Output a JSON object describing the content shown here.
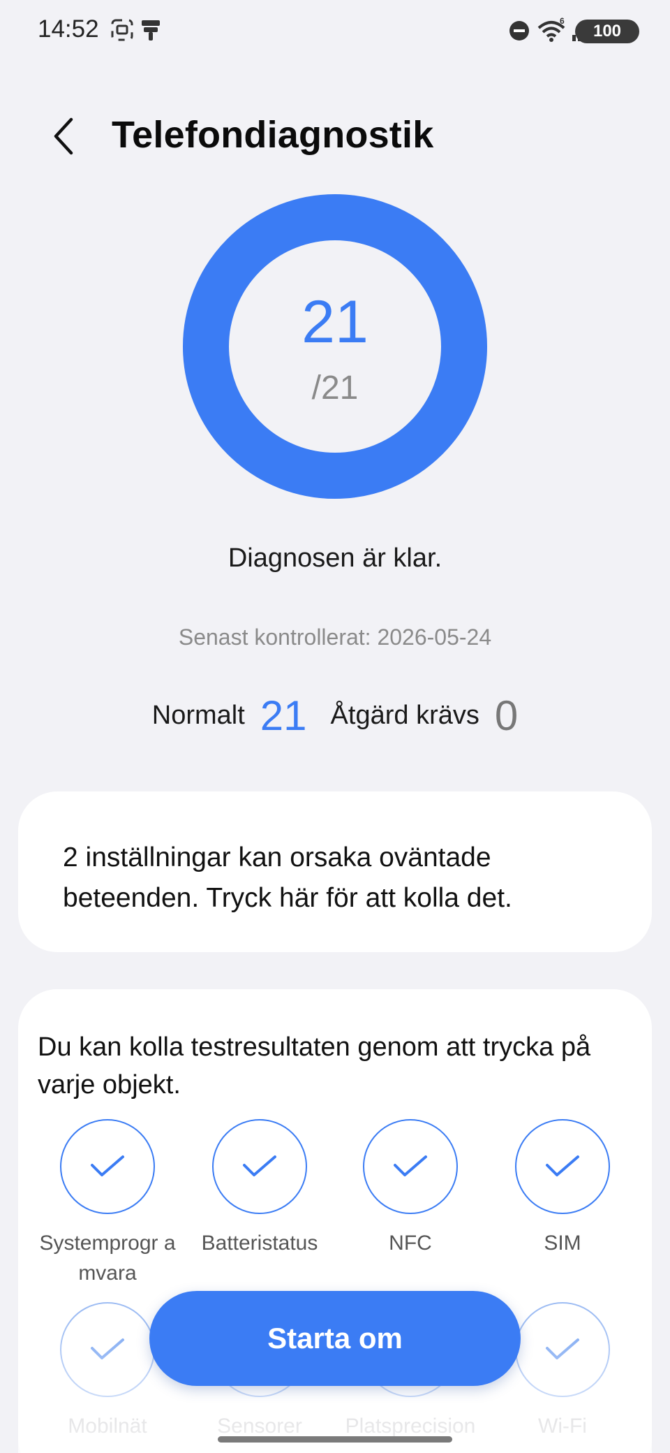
{
  "status_bar": {
    "time": "14:52",
    "battery": "100",
    "icons": [
      "screenshot-icon",
      "broom-icon",
      "do-not-disturb-icon",
      "wifi-icon",
      "signal-icon"
    ],
    "wifi_badge": "6"
  },
  "header": {
    "title": "Telefondiagnostik",
    "back_icon": "chevron-left-icon"
  },
  "score": {
    "value": "21",
    "total": "/21",
    "fraction": 1.0,
    "accent_color": "#3b7cf4"
  },
  "diagnosis_status": "Diagnosen är klar.",
  "last_checked": "Senast kontrollerat: 2026-05-24",
  "counts": {
    "normal_label": "Normalt",
    "normal_value": "21",
    "action_label": "Åtgärd krävs",
    "action_value": "0"
  },
  "settings_card": {
    "text": "2 inställningar kan orsaka oväntade beteenden. Tryck här för att kolla det."
  },
  "results_card": {
    "intro": "Du kan kolla testresultaten genom att trycka på varje objekt.",
    "items": [
      {
        "label": "Systemprogr amvara",
        "status_icon": "check-icon"
      },
      {
        "label": "Batteristatus",
        "status_icon": "check-icon"
      },
      {
        "label": "NFC",
        "status_icon": "check-icon"
      },
      {
        "label": "SIM",
        "status_icon": "check-icon"
      },
      {
        "label": "Mobilnät",
        "status_icon": "check-icon"
      },
      {
        "label": "Sensorer",
        "status_icon": "check-icon"
      },
      {
        "label": "Platsprecision",
        "status_icon": "check-icon"
      },
      {
        "label": "Wi-Fi",
        "status_icon": "check-icon"
      }
    ]
  },
  "restart_button": {
    "label": "Starta om"
  }
}
